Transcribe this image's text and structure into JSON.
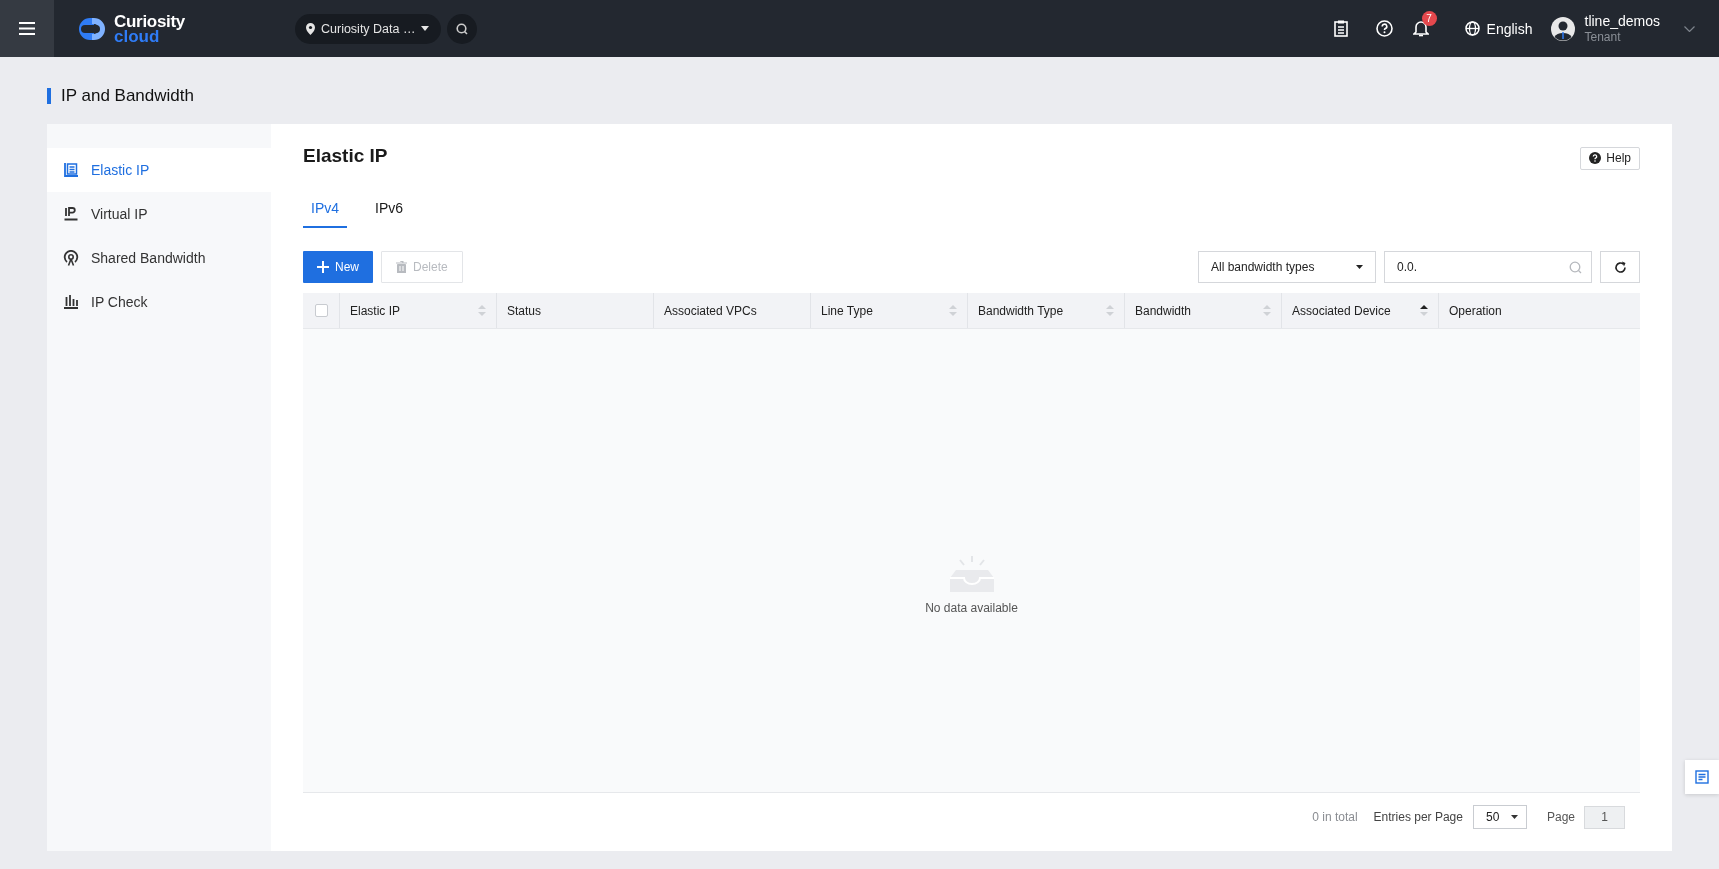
{
  "topbar": {
    "logo": {
      "line1": "Curiosity",
      "line2": "cloud"
    },
    "region": "Curiosity Data …",
    "notifications": "7",
    "language": "English",
    "user": {
      "name": "tline_demos",
      "role": "Tenant"
    }
  },
  "page_title": "IP and Bandwidth",
  "sidebar": {
    "items": [
      {
        "label": "Elastic IP",
        "selected": true
      },
      {
        "label": "Virtual IP",
        "selected": false
      },
      {
        "label": "Shared Bandwidth",
        "selected": false
      },
      {
        "label": "IP Check",
        "selected": false
      }
    ]
  },
  "panel": {
    "title": "Elastic IP",
    "help": "Help",
    "tabs": [
      {
        "label": "IPv4",
        "selected": true
      },
      {
        "label": "IPv6",
        "selected": false
      }
    ],
    "toolbar": {
      "new": "New",
      "delete": {
        "label": "Delete",
        "disabled": true
      },
      "filter": "All bandwidth types",
      "search_value": "0.0."
    },
    "table": {
      "select_all_checked": false,
      "columns": [
        {
          "label": "Elastic IP",
          "sortable": true,
          "sorted_ascending": false
        },
        {
          "label": "Status",
          "sortable": false
        },
        {
          "label": "Associated VPCs",
          "sortable": false
        },
        {
          "label": "Line Type",
          "sortable": true,
          "sorted_ascending": false
        },
        {
          "label": "Bandwidth Type",
          "sortable": true,
          "sorted_ascending": false
        },
        {
          "label": "Bandwidth",
          "sortable": true,
          "sorted_ascending": false
        },
        {
          "label": "Associated Device",
          "sortable": true,
          "sorted_ascending": true
        },
        {
          "label": "Operation",
          "sortable": false
        }
      ],
      "empty_text": "No data available"
    },
    "pagination": {
      "total": "0 in total",
      "per_page_label": "Entries per Page",
      "per_page": "50",
      "page_label": "Page",
      "page": "1"
    }
  }
}
